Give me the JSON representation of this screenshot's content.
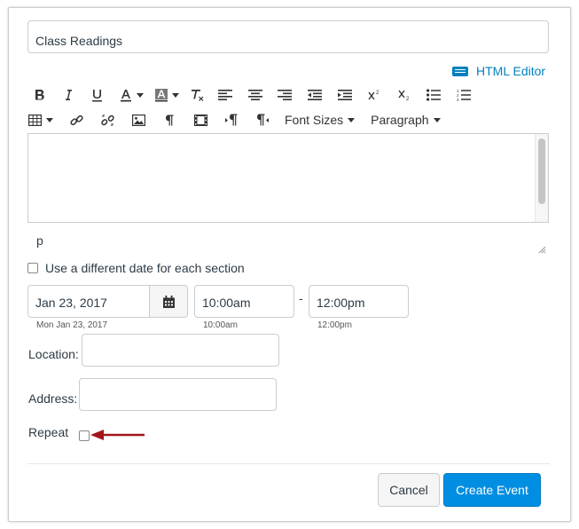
{
  "event": {
    "title_value": "Class Readings"
  },
  "editor": {
    "html_editor_label": "HTML Editor",
    "font_sizes_label": "Font Sizes",
    "paragraph_label": "Paragraph",
    "path_label": "p",
    "toolbar_row1_icons": [
      "bold-icon",
      "italic-icon",
      "underline-icon",
      "text-color-icon",
      "background-color-icon",
      "clear-formatting-icon",
      "align-left-icon",
      "align-center-icon",
      "align-right-icon",
      "outdent-icon",
      "indent-icon",
      "superscript-icon",
      "subscript-icon",
      "bullet-list-icon",
      "numbered-list-icon"
    ],
    "toolbar_row2_icons": [
      "table-icon",
      "link-icon",
      "unlink-icon",
      "image-icon",
      "paragraph-mark-icon",
      "media-icon",
      "ltr-icon",
      "rtl-icon"
    ]
  },
  "schedule": {
    "different_date_label": "Use a different date for each section",
    "date_value": "Jan 23, 2017",
    "date_hint": "Mon Jan 23, 2017",
    "start_time_value": "10:00am",
    "start_time_hint": "10:00am",
    "time_separator": "-",
    "end_time_value": "12:00pm",
    "end_time_hint": "12:00pm"
  },
  "location": {
    "location_label": "Location:",
    "address_label": "Address:"
  },
  "repeat": {
    "label": "Repeat"
  },
  "actions": {
    "cancel_label": "Cancel",
    "create_label": "Create Event"
  },
  "colors": {
    "accent": "#008ee2",
    "link": "#0081bd",
    "annotation_arrow": "#a3151a"
  }
}
